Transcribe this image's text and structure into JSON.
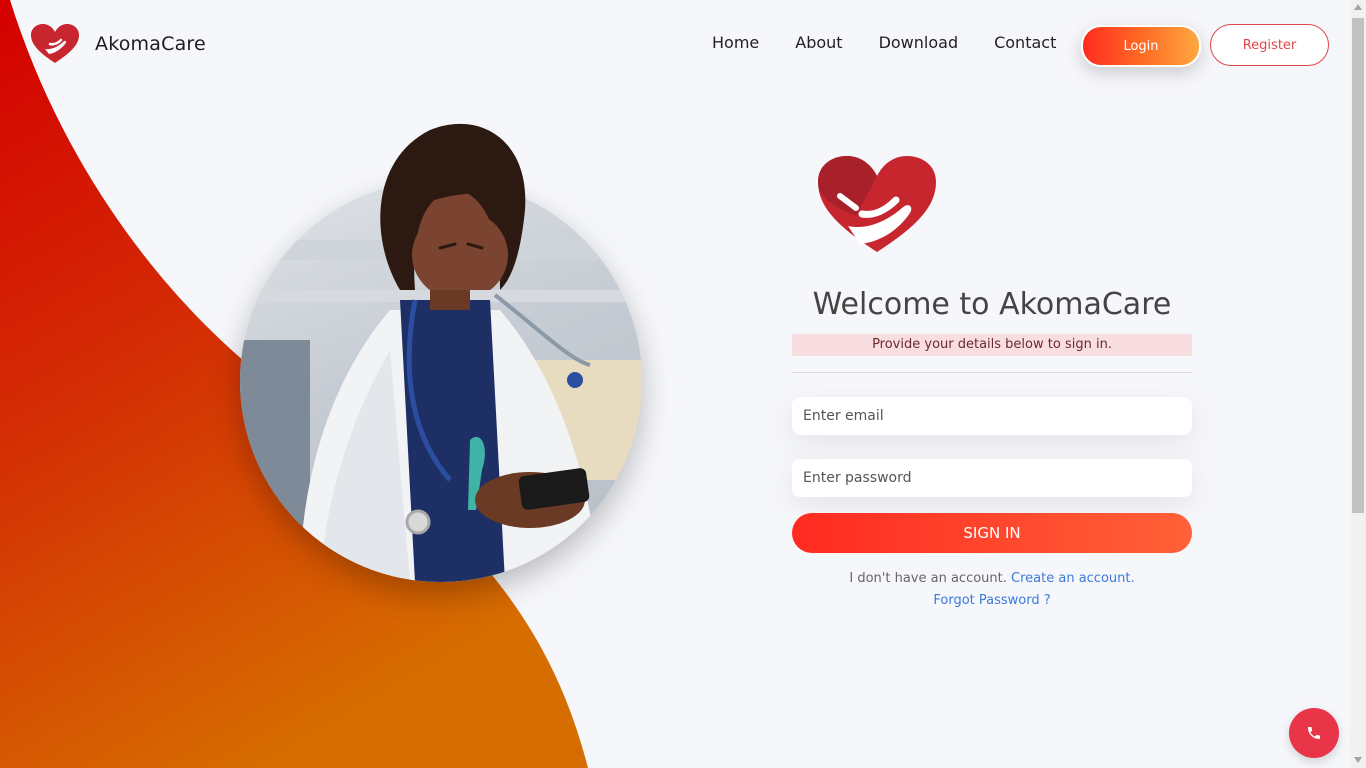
{
  "brand": {
    "name": "AkomaCare",
    "logo_icon": "heart-hand-icon"
  },
  "nav": {
    "items": [
      "Home",
      "About",
      "Download",
      "Contact"
    ]
  },
  "auth": {
    "login_label": "Login",
    "register_label": "Register"
  },
  "form": {
    "welcome": "Welcome to AkomaCare",
    "subtitle": "Provide your details below to sign in.",
    "email_placeholder": "Enter email",
    "password_placeholder": "Enter password",
    "signin_label": "SIGN IN",
    "no_account_text": "I don't have an account.",
    "create_account_link": "Create an account.",
    "forgot_password_link": "Forgot Password ?"
  },
  "floating": {
    "call_icon": "phone-icon"
  },
  "colors": {
    "brand_red": "#c8262e",
    "accent_orange": "#ff6a24",
    "link_blue": "#3b7bd8",
    "call_button": "#e83548"
  }
}
